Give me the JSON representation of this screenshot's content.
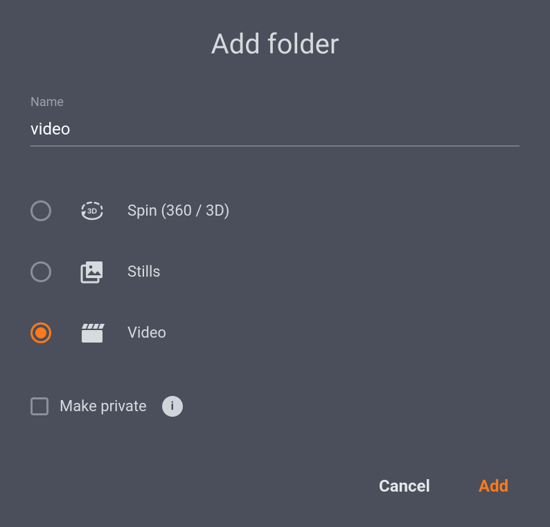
{
  "dialog": {
    "title": "Add folder"
  },
  "name_field": {
    "label": "Name",
    "value": "video"
  },
  "options": [
    {
      "id": "spin",
      "label": "Spin (360 / 3D)",
      "selected": false
    },
    {
      "id": "stills",
      "label": "Stills",
      "selected": false
    },
    {
      "id": "video",
      "label": "Video",
      "selected": true
    }
  ],
  "make_private": {
    "label": "Make private",
    "checked": false
  },
  "info_glyph": "i",
  "actions": {
    "cancel": "Cancel",
    "add": "Add"
  },
  "colors": {
    "accent": "#ff7a1a",
    "background": "#4a4f5b"
  }
}
